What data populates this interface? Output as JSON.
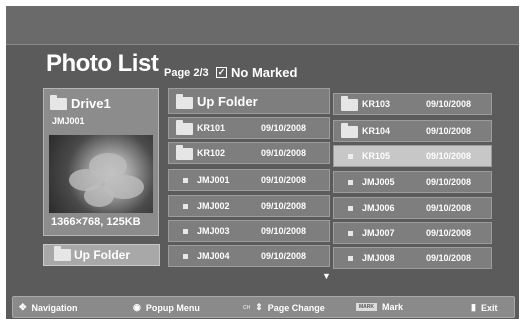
{
  "header": {
    "title": "Photo List",
    "page": "Page 2/3",
    "mark_status": "No Marked"
  },
  "drive_panel": {
    "drive_name": "Drive1",
    "folder_name": "JMJ001",
    "info": "1366×768, 125KB"
  },
  "up_folder_button": "Up Folder",
  "grid": {
    "left": [
      {
        "name": "Up Folder",
        "date": ""
      },
      {
        "name": "KR101",
        "date": "09/10/2008"
      },
      {
        "name": "KR102",
        "date": "09/10/2008"
      },
      {
        "name": "JMJ001",
        "date": "09/10/2008"
      },
      {
        "name": "JMJ002",
        "date": "09/10/2008"
      },
      {
        "name": "JMJ003",
        "date": "09/10/2008"
      },
      {
        "name": "JMJ004",
        "date": "09/10/2008"
      }
    ],
    "right": [
      {
        "name": "KR103",
        "date": "09/10/2008"
      },
      {
        "name": "KR104",
        "date": "09/10/2008"
      },
      {
        "name": "KR105",
        "date": "09/10/2008"
      },
      {
        "name": "JMJ005",
        "date": "09/10/2008"
      },
      {
        "name": "JMJ006",
        "date": "09/10/2008"
      },
      {
        "name": "JMJ007",
        "date": "09/10/2008"
      },
      {
        "name": "JMJ008",
        "date": "09/10/2008"
      }
    ]
  },
  "footer": {
    "navigation": "Navigation",
    "popup_menu": "Popup Menu",
    "ch_label": "CH",
    "page_change": "Page Change",
    "mark_key": "MARK",
    "mark": "Mark",
    "exit": "Exit"
  }
}
